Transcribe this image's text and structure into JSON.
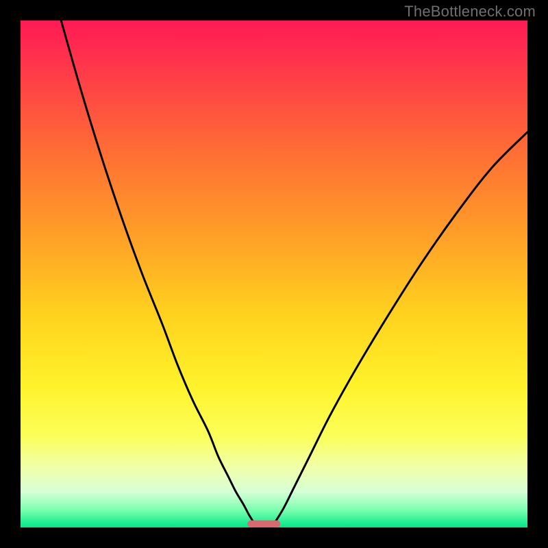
{
  "watermark": "TheBottleneck.com",
  "colors": {
    "frame": "#000000",
    "curve": "#000000",
    "marker": "#d86a6f",
    "gradient_stops": [
      {
        "offset": 0.0,
        "color": "#ff1a55"
      },
      {
        "offset": 0.1,
        "color": "#ff3a49"
      },
      {
        "offset": 0.25,
        "color": "#ff6b35"
      },
      {
        "offset": 0.43,
        "color": "#ffa127"
      },
      {
        "offset": 0.58,
        "color": "#ffd21e"
      },
      {
        "offset": 0.72,
        "color": "#fff22a"
      },
      {
        "offset": 0.82,
        "color": "#fbff5a"
      },
      {
        "offset": 0.88,
        "color": "#f1ffa8"
      },
      {
        "offset": 0.93,
        "color": "#d6ffd6"
      },
      {
        "offset": 0.965,
        "color": "#7cffb0"
      },
      {
        "offset": 1.0,
        "color": "#00e888"
      }
    ]
  },
  "chart_data": {
    "type": "line",
    "title": "",
    "xlabel": "",
    "ylabel": "",
    "xlim": [
      0,
      100
    ],
    "ylim": [
      0,
      100
    ],
    "series": [
      {
        "name": "left-branch",
        "x": [
          8,
          12,
          16,
          20,
          24,
          28,
          31,
          34,
          37,
          39,
          41,
          42.5,
          44,
          45,
          45.8,
          46.2
        ],
        "y": [
          100,
          86,
          73,
          61,
          50,
          40,
          32,
          25,
          19,
          14,
          10,
          7,
          4.5,
          2.6,
          1.3,
          0.5
        ]
      },
      {
        "name": "right-branch",
        "x": [
          49.8,
          50.5,
          52,
          54,
          57,
          61,
          66,
          72,
          79,
          86,
          93,
          100
        ],
        "y": [
          0.5,
          1.5,
          4,
          8,
          14,
          22,
          31,
          41,
          52,
          62,
          71,
          78
        ]
      }
    ],
    "marker": {
      "name": "bottleneck-region",
      "x_center": 48,
      "y_center": 0.7,
      "width": 6.5,
      "height": 1.4
    }
  }
}
